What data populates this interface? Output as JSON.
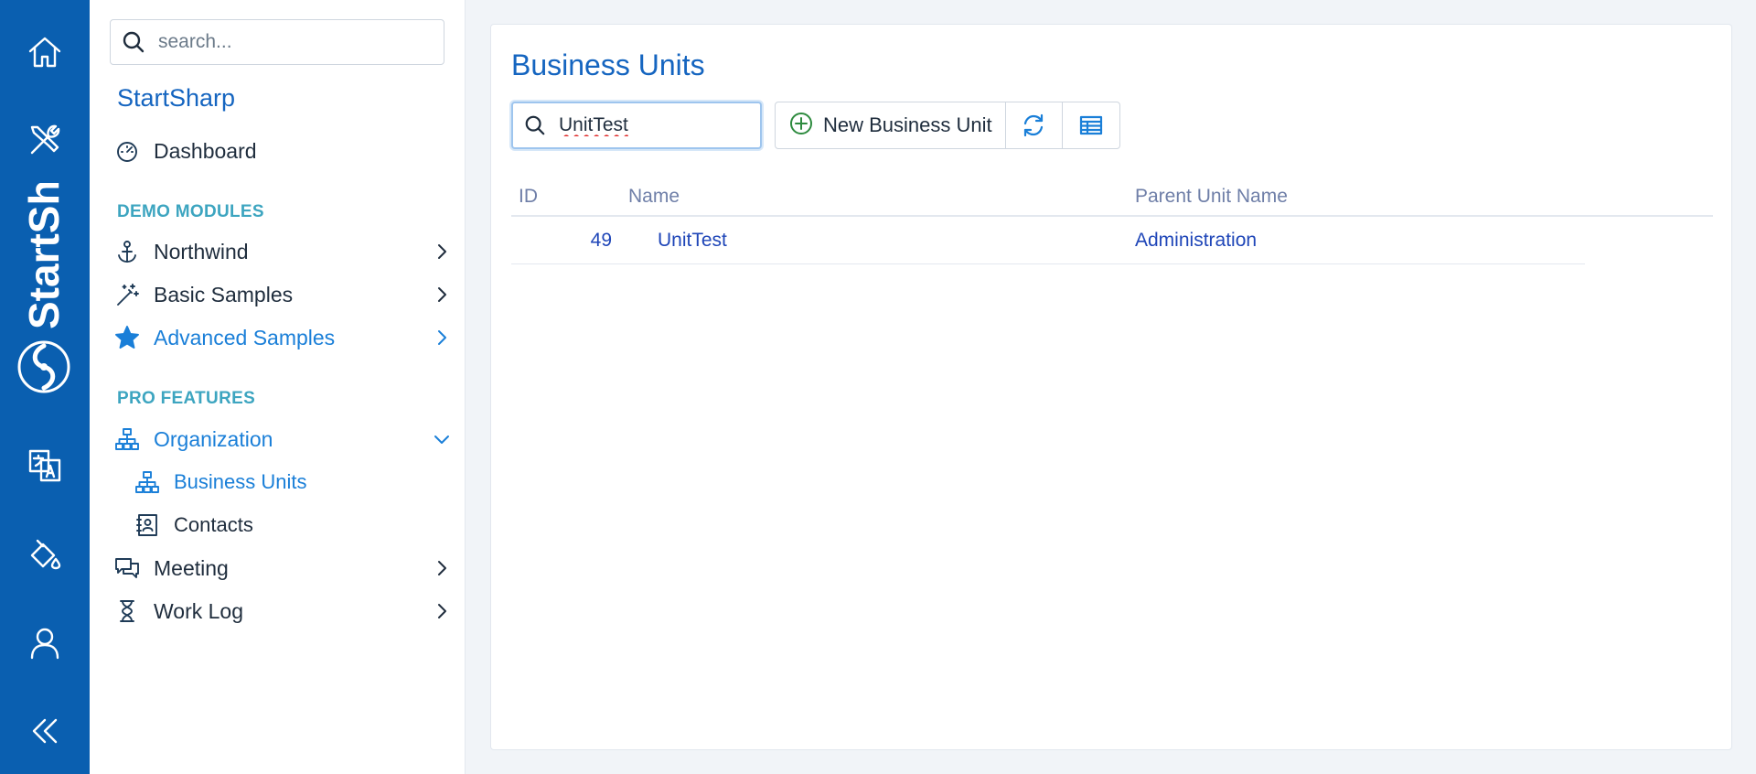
{
  "rail": {
    "brand_text": "StartSh",
    "items": [
      {
        "icon": "home-icon"
      },
      {
        "icon": "tools-icon"
      },
      {
        "icon": "translate-icon"
      },
      {
        "icon": "paint-bucket-icon"
      },
      {
        "icon": "user-icon"
      },
      {
        "icon": "collapse-icon"
      }
    ]
  },
  "sidebar": {
    "search_placeholder": "search...",
    "app_name": "StartSharp",
    "dashboard": "Dashboard",
    "sections": {
      "demo": "DEMO MODULES",
      "pro": "PRO FEATURES"
    },
    "items": {
      "northwind": "Northwind",
      "basic_samples": "Basic Samples",
      "advanced_samples": "Advanced Samples",
      "organization": "Organization",
      "business_units": "Business Units",
      "contacts": "Contacts",
      "meeting": "Meeting",
      "work_log": "Work Log"
    }
  },
  "main": {
    "title": "Business Units",
    "search_value": "UnitTest",
    "toolbar": {
      "new_label": "New Business Unit"
    },
    "columns": {
      "id": "ID",
      "name": "Name",
      "parent": "Parent Unit Name"
    },
    "rows": [
      {
        "id": "49",
        "name": "UnitTest",
        "parent": "Administration"
      }
    ]
  },
  "colors": {
    "rail": "#0a5fb0",
    "accent": "#1565c0",
    "active": "#1a7fd8",
    "section": "#3da5c0",
    "add": "#2e8b3f"
  }
}
